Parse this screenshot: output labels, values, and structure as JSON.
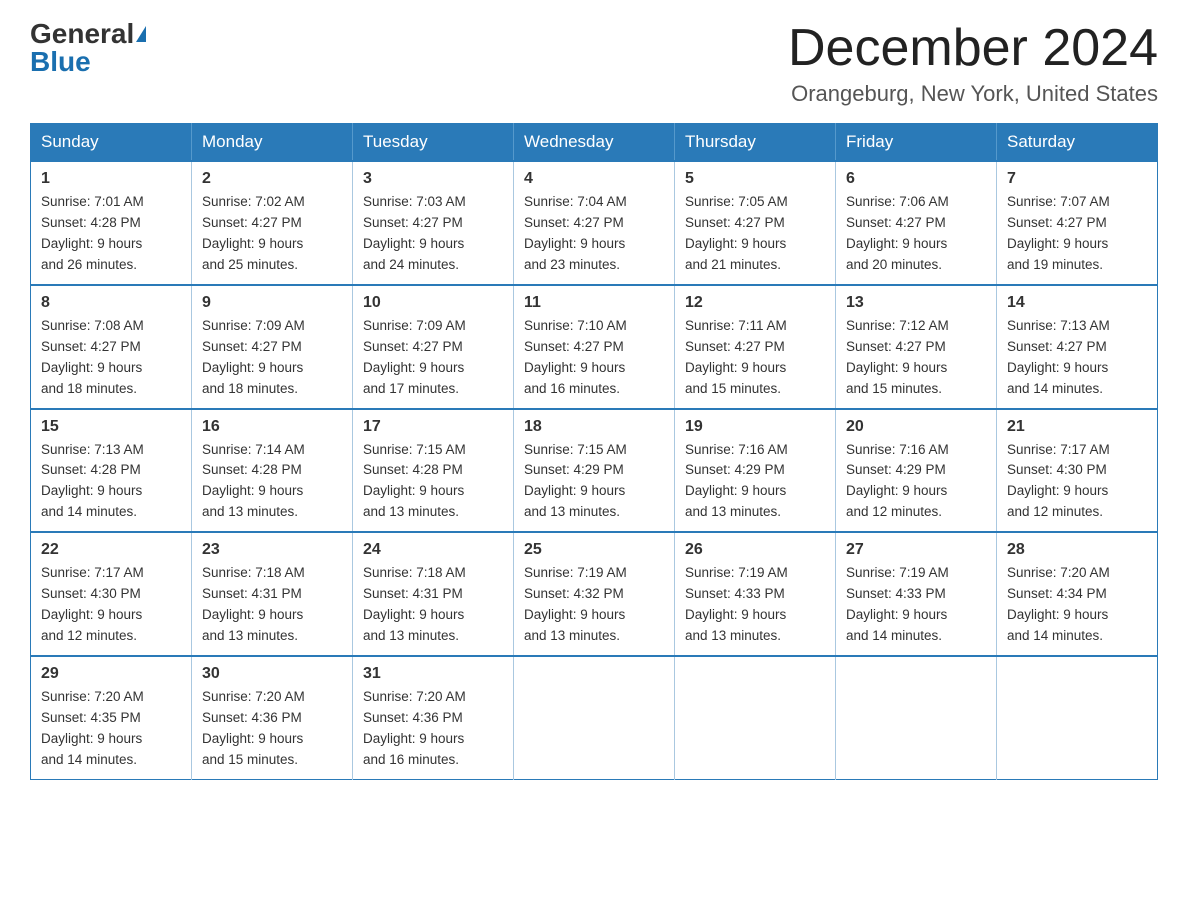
{
  "header": {
    "logo_general": "General",
    "logo_blue": "Blue",
    "title": "December 2024",
    "subtitle": "Orangeburg, New York, United States"
  },
  "days_of_week": [
    "Sunday",
    "Monday",
    "Tuesday",
    "Wednesday",
    "Thursday",
    "Friday",
    "Saturday"
  ],
  "weeks": [
    [
      {
        "num": "1",
        "sunrise": "7:01 AM",
        "sunset": "4:28 PM",
        "daylight": "9 hours and 26 minutes."
      },
      {
        "num": "2",
        "sunrise": "7:02 AM",
        "sunset": "4:27 PM",
        "daylight": "9 hours and 25 minutes."
      },
      {
        "num": "3",
        "sunrise": "7:03 AM",
        "sunset": "4:27 PM",
        "daylight": "9 hours and 24 minutes."
      },
      {
        "num": "4",
        "sunrise": "7:04 AM",
        "sunset": "4:27 PM",
        "daylight": "9 hours and 23 minutes."
      },
      {
        "num": "5",
        "sunrise": "7:05 AM",
        "sunset": "4:27 PM",
        "daylight": "9 hours and 21 minutes."
      },
      {
        "num": "6",
        "sunrise": "7:06 AM",
        "sunset": "4:27 PM",
        "daylight": "9 hours and 20 minutes."
      },
      {
        "num": "7",
        "sunrise": "7:07 AM",
        "sunset": "4:27 PM",
        "daylight": "9 hours and 19 minutes."
      }
    ],
    [
      {
        "num": "8",
        "sunrise": "7:08 AM",
        "sunset": "4:27 PM",
        "daylight": "9 hours and 18 minutes."
      },
      {
        "num": "9",
        "sunrise": "7:09 AM",
        "sunset": "4:27 PM",
        "daylight": "9 hours and 18 minutes."
      },
      {
        "num": "10",
        "sunrise": "7:09 AM",
        "sunset": "4:27 PM",
        "daylight": "9 hours and 17 minutes."
      },
      {
        "num": "11",
        "sunrise": "7:10 AM",
        "sunset": "4:27 PM",
        "daylight": "9 hours and 16 minutes."
      },
      {
        "num": "12",
        "sunrise": "7:11 AM",
        "sunset": "4:27 PM",
        "daylight": "9 hours and 15 minutes."
      },
      {
        "num": "13",
        "sunrise": "7:12 AM",
        "sunset": "4:27 PM",
        "daylight": "9 hours and 15 minutes."
      },
      {
        "num": "14",
        "sunrise": "7:13 AM",
        "sunset": "4:27 PM",
        "daylight": "9 hours and 14 minutes."
      }
    ],
    [
      {
        "num": "15",
        "sunrise": "7:13 AM",
        "sunset": "4:28 PM",
        "daylight": "9 hours and 14 minutes."
      },
      {
        "num": "16",
        "sunrise": "7:14 AM",
        "sunset": "4:28 PM",
        "daylight": "9 hours and 13 minutes."
      },
      {
        "num": "17",
        "sunrise": "7:15 AM",
        "sunset": "4:28 PM",
        "daylight": "9 hours and 13 minutes."
      },
      {
        "num": "18",
        "sunrise": "7:15 AM",
        "sunset": "4:29 PM",
        "daylight": "9 hours and 13 minutes."
      },
      {
        "num": "19",
        "sunrise": "7:16 AM",
        "sunset": "4:29 PM",
        "daylight": "9 hours and 13 minutes."
      },
      {
        "num": "20",
        "sunrise": "7:16 AM",
        "sunset": "4:29 PM",
        "daylight": "9 hours and 12 minutes."
      },
      {
        "num": "21",
        "sunrise": "7:17 AM",
        "sunset": "4:30 PM",
        "daylight": "9 hours and 12 minutes."
      }
    ],
    [
      {
        "num": "22",
        "sunrise": "7:17 AM",
        "sunset": "4:30 PM",
        "daylight": "9 hours and 12 minutes."
      },
      {
        "num": "23",
        "sunrise": "7:18 AM",
        "sunset": "4:31 PM",
        "daylight": "9 hours and 13 minutes."
      },
      {
        "num": "24",
        "sunrise": "7:18 AM",
        "sunset": "4:31 PM",
        "daylight": "9 hours and 13 minutes."
      },
      {
        "num": "25",
        "sunrise": "7:19 AM",
        "sunset": "4:32 PM",
        "daylight": "9 hours and 13 minutes."
      },
      {
        "num": "26",
        "sunrise": "7:19 AM",
        "sunset": "4:33 PM",
        "daylight": "9 hours and 13 minutes."
      },
      {
        "num": "27",
        "sunrise": "7:19 AM",
        "sunset": "4:33 PM",
        "daylight": "9 hours and 14 minutes."
      },
      {
        "num": "28",
        "sunrise": "7:20 AM",
        "sunset": "4:34 PM",
        "daylight": "9 hours and 14 minutes."
      }
    ],
    [
      {
        "num": "29",
        "sunrise": "7:20 AM",
        "sunset": "4:35 PM",
        "daylight": "9 hours and 14 minutes."
      },
      {
        "num": "30",
        "sunrise": "7:20 AM",
        "sunset": "4:36 PM",
        "daylight": "9 hours and 15 minutes."
      },
      {
        "num": "31",
        "sunrise": "7:20 AM",
        "sunset": "4:36 PM",
        "daylight": "9 hours and 16 minutes."
      },
      null,
      null,
      null,
      null
    ]
  ],
  "labels": {
    "sunrise": "Sunrise:",
    "sunset": "Sunset:",
    "daylight": "Daylight:"
  }
}
